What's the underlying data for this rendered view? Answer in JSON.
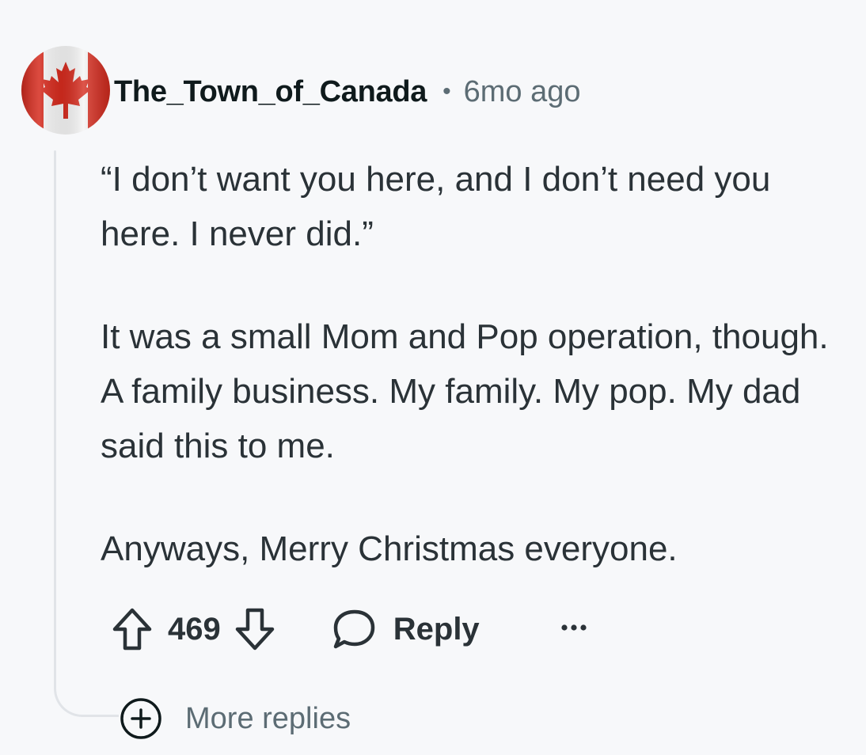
{
  "comment": {
    "author": "The_Town_of_Canada",
    "separator": "•",
    "timestamp": "6mo ago",
    "avatar_icon": "canada-flag-avatar",
    "paragraphs": [
      "“I don’t want you here, and I don’t need you here. I never did.”",
      "It was a small Mom and Pop operation, though. A family business. My family. My pop. My dad said this to me.",
      "Anyways, Merry Christmas everyone."
    ]
  },
  "actions": {
    "upvote_icon": "upvote-arrow-icon",
    "vote_count": "469",
    "downvote_icon": "downvote-arrow-icon",
    "reply_icon": "speech-bubble-icon",
    "reply_label": "Reply",
    "more_icon": "ellipsis-icon"
  },
  "more_replies": {
    "icon": "plus-circle-icon",
    "label": "More replies"
  },
  "colors": {
    "background": "#f7f8fa",
    "text_primary": "#2a3237",
    "text_secondary": "#5c6c74",
    "flag_red": "#d52b1e",
    "thread_line": "#e1e4e8"
  }
}
